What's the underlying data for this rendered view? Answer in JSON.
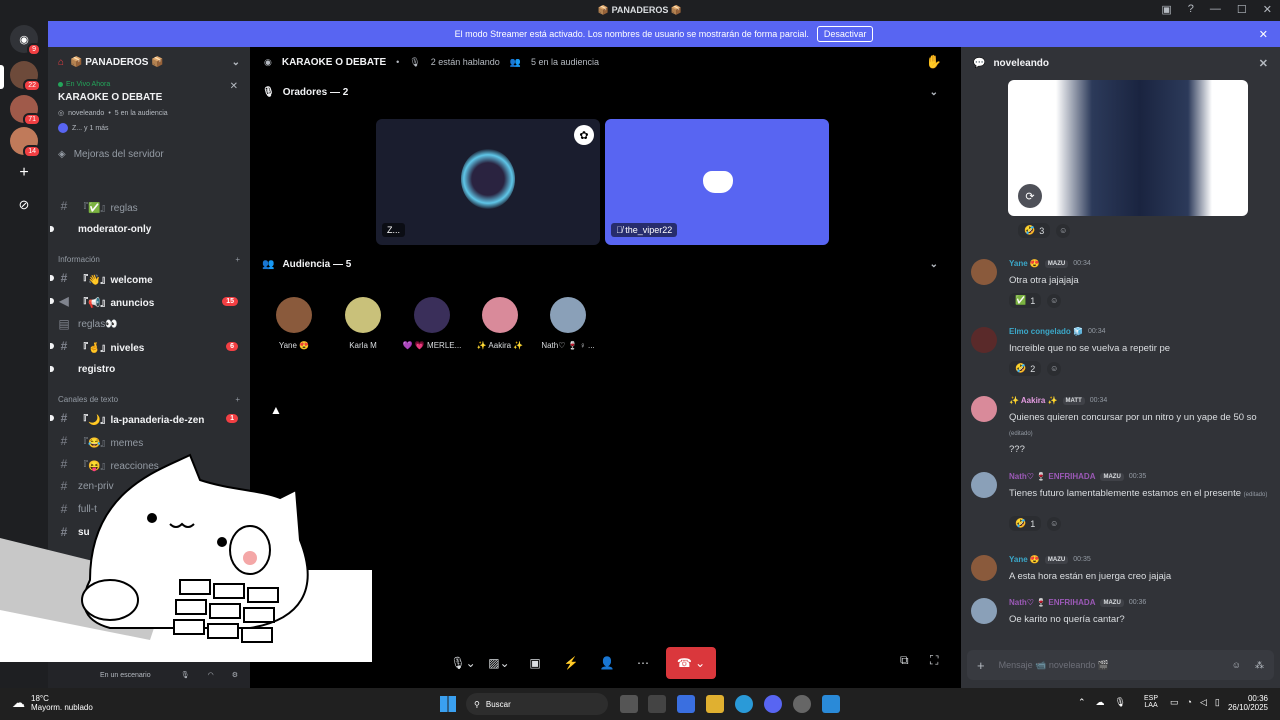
{
  "window": {
    "title": "📦 PANADEROS 📦"
  },
  "banner": {
    "text": "El modo Streamer está activado. Los nombres de usuario se mostrarán de forma parcial.",
    "button": "Desactivar"
  },
  "rail": {
    "badges": [
      "9",
      "22",
      "71",
      "14"
    ]
  },
  "server": {
    "name": "📦 PANADEROS 📦"
  },
  "live": {
    "status": "En Vivo Ahora",
    "stage_name": "KARAOKE O DEBATE",
    "host": "noveleando",
    "audience": "5 en la audiencia",
    "since": "Z... y 1 más"
  },
  "boost": {
    "label": "Mejoras del servidor"
  },
  "channels": {
    "reglas1": "『✅』reglas",
    "moderator": "moderator-only",
    "cat_info": "Información",
    "welcome": "『👋』welcome",
    "anuncios": "『📢』anuncios",
    "anuncios_count": "15",
    "reglas2": "reglas👀",
    "niveles": "『🤞』niveles",
    "niveles_count": "6",
    "registro": "registro",
    "cat_text": "Canales de texto",
    "panaderia": "『🌙』la-panaderia-de-zen",
    "panaderia_count": "1",
    "memes": "『😂』memes",
    "reacciones": "『😝』reacciones",
    "zenpriv": "zen-priv",
    "full": "full-t",
    "su": "su"
  },
  "userbar": {
    "status": "En un escenario"
  },
  "stage": {
    "title": "KARAOKE O DEBATE",
    "speaking": "2 están hablando",
    "audience": "5 en la audiencia",
    "speakers_header": "Oradores — 2",
    "audience_header": "Audiencia — 5",
    "speakers": [
      {
        "name": "Z..."
      },
      {
        "name": "the_viper22"
      }
    ],
    "audience_members": [
      {
        "name": "Yane 😍",
        "color": "#8a5a3c"
      },
      {
        "name": "Karla M",
        "color": "#c9c17a"
      },
      {
        "name": "💜 💗 MERLE...",
        "color": "#3a2f5a"
      },
      {
        "name": "✨ Aakira ✨",
        "color": "#d98a9a"
      },
      {
        "name": "Nath♡ 🍷 ♀ ...",
        "color": "#8aa0b8"
      }
    ]
  },
  "chat": {
    "channel": "noveleando",
    "input_placeholder": "Mensaje 📹 noveleando 🎬",
    "top_reaction": {
      "emoji": "🤣",
      "count": "3"
    },
    "messages": [
      {
        "name": "Yane 😍",
        "tag": "MAZU",
        "time": "00:34",
        "text": "Otra otra jajajaja",
        "react": "✅",
        "count": "1",
        "color": "#3ba7c8"
      },
      {
        "name": "Elmo congelado 🧊",
        "tag": "",
        "time": "00:34",
        "text": "Increible que no se vuelva a repetir pe",
        "react": "🤣",
        "count": "2",
        "color": "#3ba7c8"
      },
      {
        "name": "✨ Aakira ✨",
        "tag": "MATT",
        "time": "00:34",
        "text": "Quienes quieren concursar  por un nitro y un yape de 50 so",
        "edited": "(editado)",
        "extra": "???",
        "color": "#e39be0"
      },
      {
        "name": "Nath♡ 🍷 ENFRIHADA",
        "tag": "MAZU",
        "time": "00:35",
        "text": "Tienes futuro lamentablemente estamos en el presente",
        "edited": "(editado)",
        "react": "🤣",
        "count": "1",
        "color": "#9b59b6"
      },
      {
        "name": "Yane 😍",
        "tag": "MAZU",
        "time": "00:35",
        "text": "A esta hora están en juerga creo jajaja",
        "color": "#3ba7c8"
      },
      {
        "name": "Nath♡ 🍷 ENFRIHADA",
        "tag": "MAZU",
        "time": "00:36",
        "text": "Oe karito no quería cantar?",
        "color": "#9b59b6"
      }
    ]
  },
  "taskbar": {
    "weather_temp": "18°C",
    "weather_desc": "Mayorm. nublado",
    "search": "Buscar",
    "lang1": "ESP",
    "lang2": "LAA",
    "time": "00:36",
    "date": "26/10/2025"
  }
}
